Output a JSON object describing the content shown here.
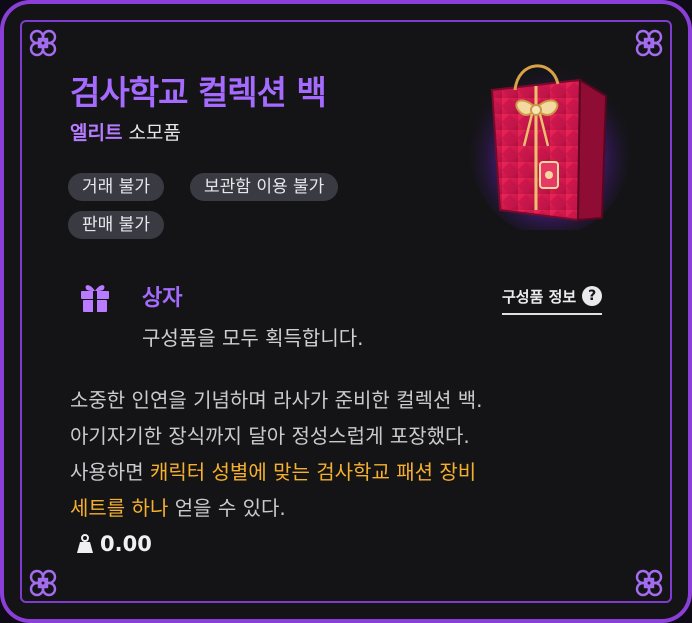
{
  "item": {
    "name": "검사학교 컬렉션 백",
    "grade": "엘리트",
    "category": "소모품"
  },
  "tags": [
    "거래 불가",
    "보관함 이용 불가",
    "판매 불가"
  ],
  "box": {
    "type": "상자",
    "description": "구성품을 모두 획득합니다.",
    "components_label": "구성품 정보"
  },
  "description": {
    "line1": "소중한 인연을 기념하며 라사가 준비한 컬렉션 백.",
    "line2": "아기자기한 장식까지 달아 정성스럽게 포장했다.",
    "line3_prefix": "사용하면 ",
    "line3_highlight": "캐릭터 성별에 맞는 검사학교 패션 장비",
    "line4_highlight": "세트를 하나",
    "line4_suffix": " 얻을 수 있다."
  },
  "weight": "0.00",
  "colors": {
    "frame": "#8a3fd9",
    "title": "#a56bff",
    "highlight": "#f5b02f",
    "tag_bg": "#3a3a42"
  },
  "icons": {
    "corner": "ornament-icon",
    "gift": "gift-icon",
    "help": "question-icon",
    "weight": "weight-icon"
  }
}
